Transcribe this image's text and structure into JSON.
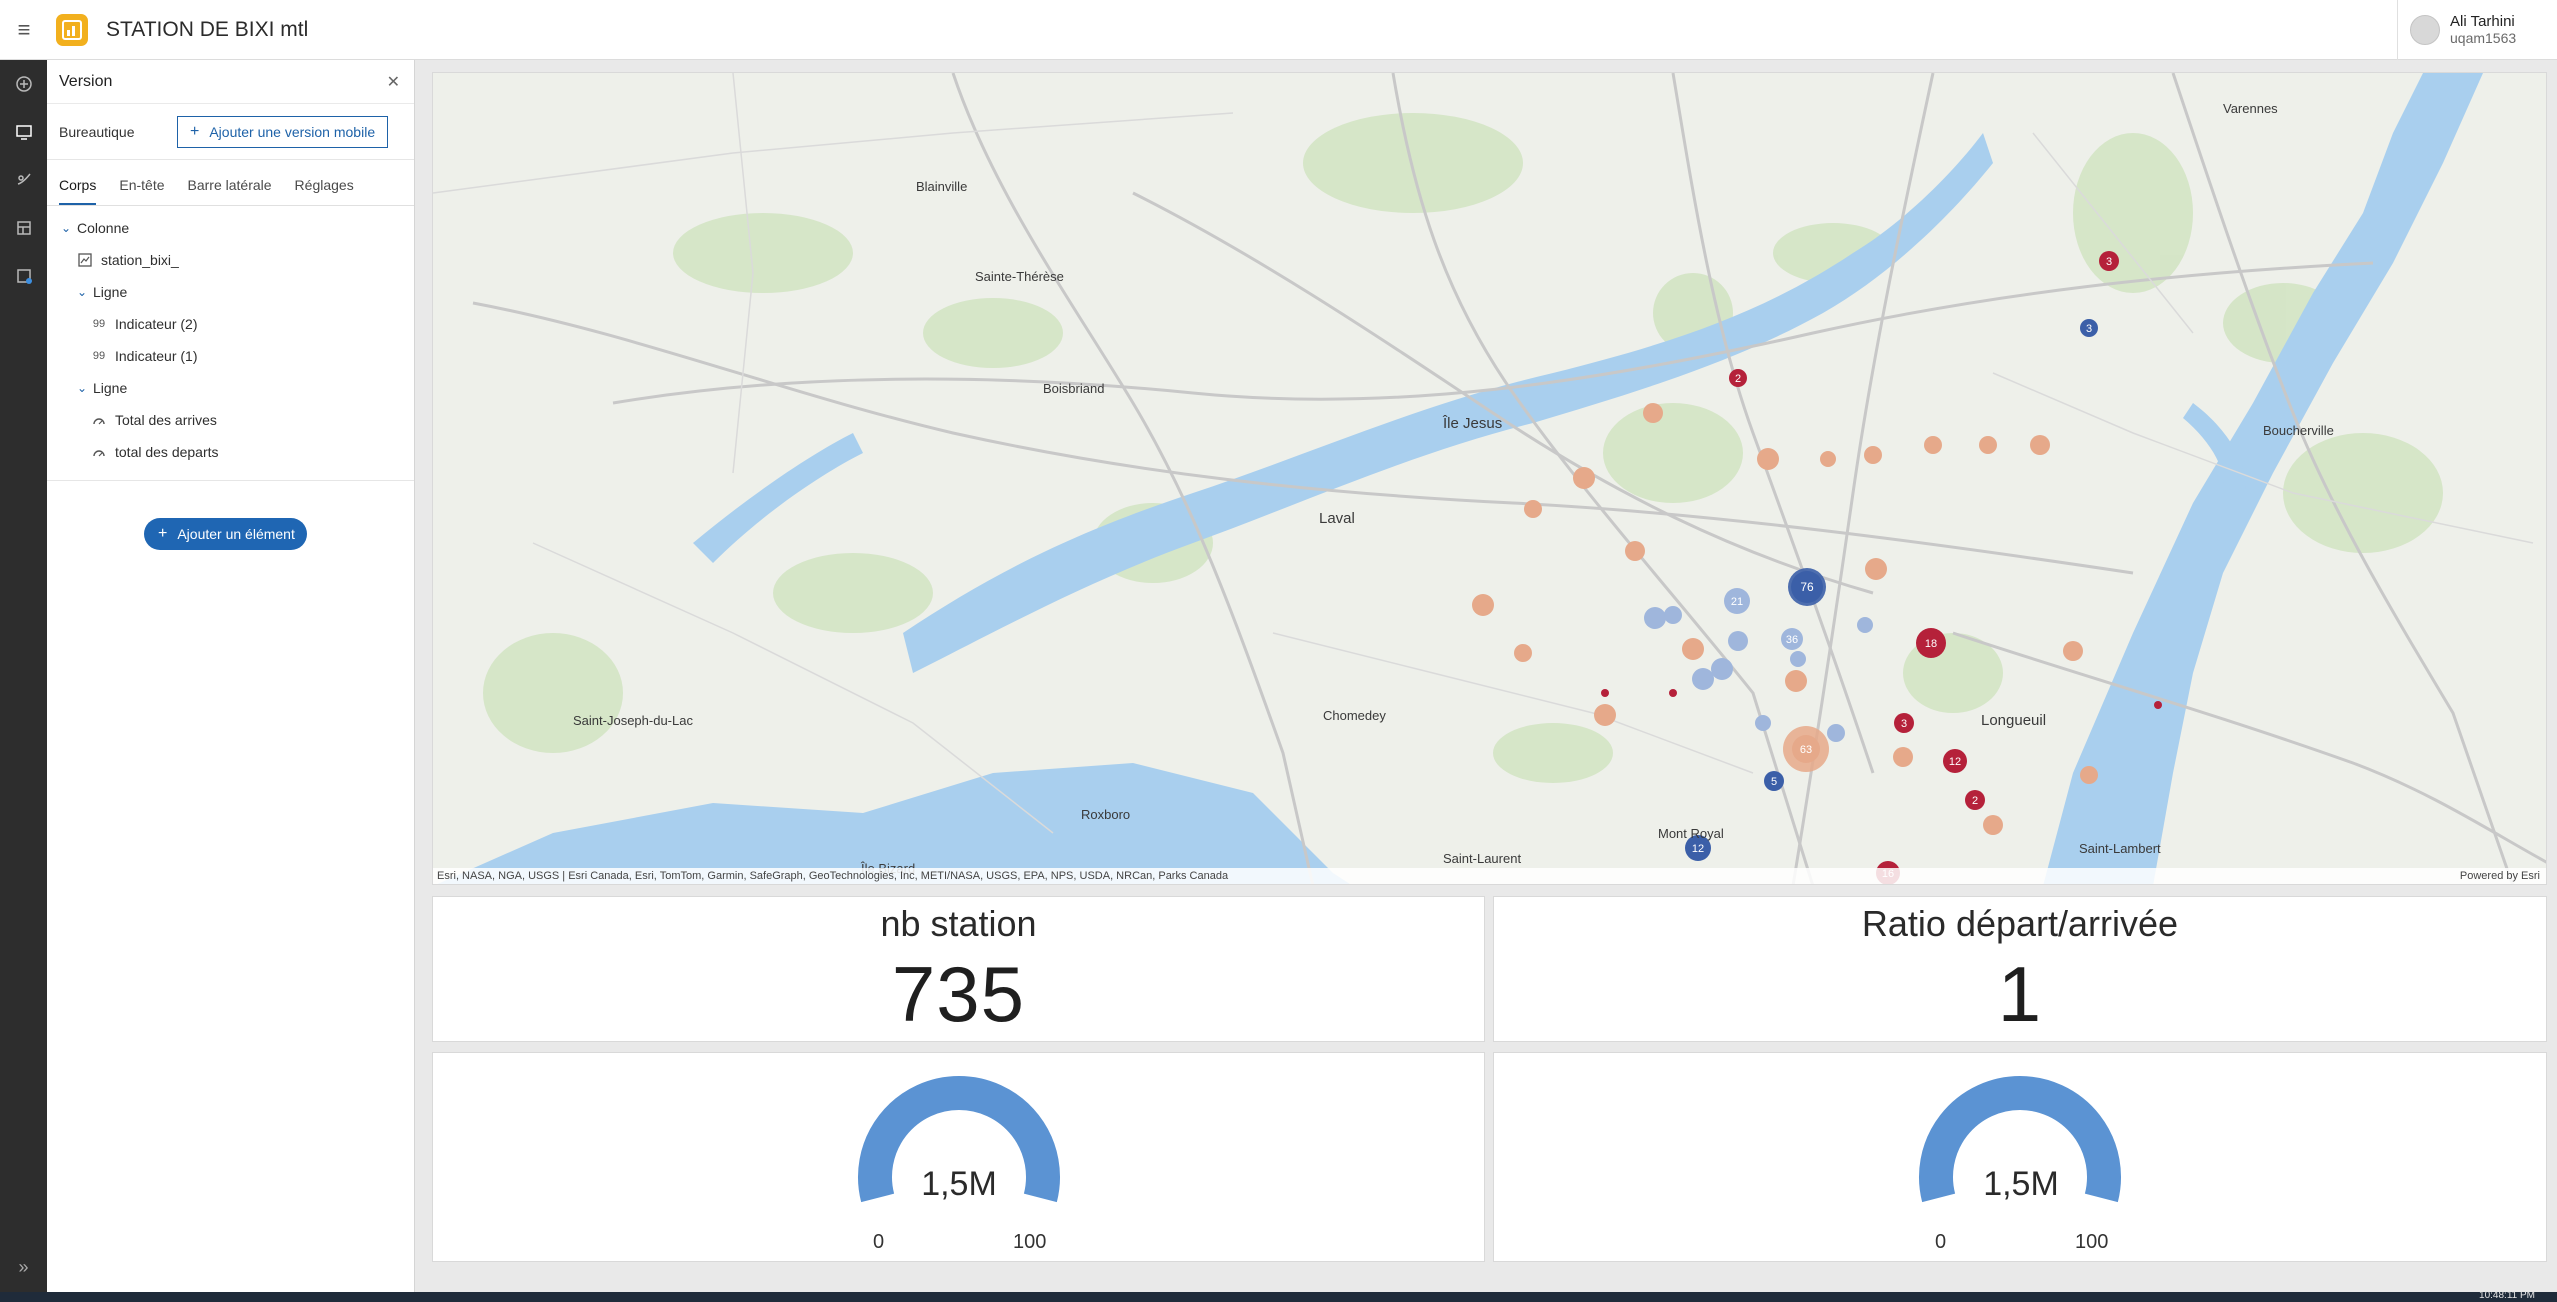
{
  "app": {
    "title": "STATION DE BIXI mtl"
  },
  "user": {
    "name": "Ali Tarhini",
    "login": "uqam1563"
  },
  "panel": {
    "title": "Version",
    "version_label": "Bureautique",
    "add_mobile_label": "Ajouter une version mobile",
    "tabs": [
      "Corps",
      "En-tête",
      "Barre latérale",
      "Réglages"
    ],
    "tree": [
      {
        "label": "Colonne",
        "level": 0,
        "type": "group"
      },
      {
        "label": "station_bixi_",
        "level": 1,
        "type": "map"
      },
      {
        "label": "Ligne",
        "level": 1,
        "type": "group"
      },
      {
        "label": "Indicateur (2)",
        "level": 2,
        "type": "indicator"
      },
      {
        "label": "Indicateur (1)",
        "level": 2,
        "type": "indicator"
      },
      {
        "label": "Ligne",
        "level": 1,
        "type": "group"
      },
      {
        "label": "Total des arrives",
        "level": 2,
        "type": "gauge"
      },
      {
        "label": "total des departs",
        "level": 2,
        "type": "gauge"
      }
    ],
    "add_element_label": "Ajouter un élément"
  },
  "map": {
    "attribution": "Esri, NASA, NGA, USGS | Esri Canada, Esri, TomTom, Garmin, SafeGraph, GeoTechnologies, Inc, METI/NASA, USGS, EPA, NPS, USDA, NRCan, Parks Canada",
    "powered_by": "Powered by Esri",
    "labels": [
      "Blainville",
      "Sainte-Thérèse",
      "Boisbriand",
      "Île Jesus",
      "Laval",
      "Varennes",
      "Boucherville",
      "Longueuil",
      "Saint-Laurent",
      "Mont Royal",
      "Roxboro",
      "Île Bizard",
      "Saint-Joseph-du-Lac",
      "Chomedey",
      "Saint-Lambert"
    ]
  },
  "indicators": [
    {
      "title": "nb station",
      "value": "735"
    },
    {
      "title": "Ratio départ/arrivée",
      "value": "1"
    }
  ],
  "gauges": [
    {
      "center": "1,5M",
      "min": "0",
      "max": "100",
      "fill_fraction": 1.0,
      "color": "#5b93d3"
    },
    {
      "center": "1,5M",
      "min": "0",
      "max": "100",
      "fill_fraction": 1.0,
      "color": "#5b93d3"
    }
  ],
  "taskbar": {
    "clock": "10:48:11 PM"
  },
  "colors": {
    "accent": "#1e62a8",
    "logo": "#f2b01e",
    "cluster_red": "#b5213a",
    "cluster_blue": "#3b5fa8",
    "cluster_peach": "#e6a98a"
  }
}
